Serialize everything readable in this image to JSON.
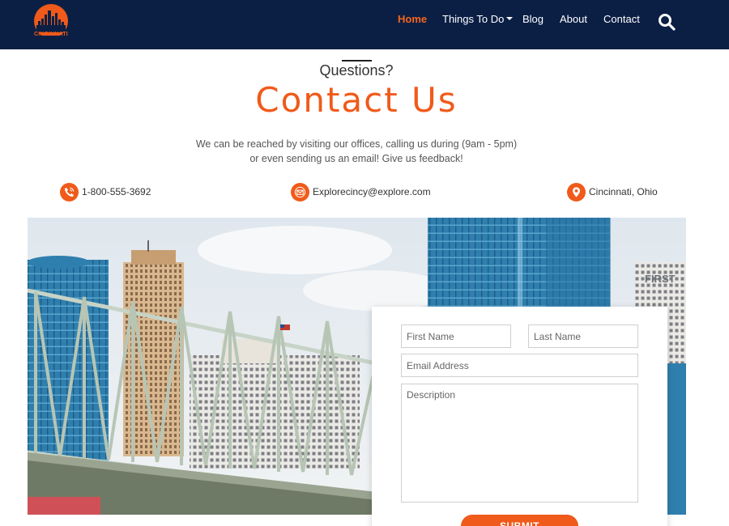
{
  "nav": {
    "logo_text": "CINCINNATI",
    "links": [
      {
        "label": "Home",
        "active": true
      },
      {
        "label": "Things To Do",
        "dropdown": true
      },
      {
        "label": "Blog"
      },
      {
        "label": "About"
      },
      {
        "label": "Contact"
      }
    ],
    "search_icon": "search-icon"
  },
  "header": {
    "eyebrow": "Questions?",
    "title": "Contact Us",
    "description_line1": "We can be reached by visiting our offices, calling us during (9am - 5pm)",
    "description_line2": "or even sending us an email! Give us feedback!"
  },
  "contact": {
    "phone": "1-800-555-3692",
    "email": "Explorecincy@explore.com",
    "location": "Cincinnati, Ohio"
  },
  "form": {
    "first_name_placeholder": "First Name",
    "last_name_placeholder": "Last Name",
    "email_placeholder": "Email Address",
    "description_placeholder": "Description",
    "submit_label": "SUBMIT"
  },
  "colors": {
    "navbar": "#0b1f45",
    "accent": "#f05a1a"
  }
}
